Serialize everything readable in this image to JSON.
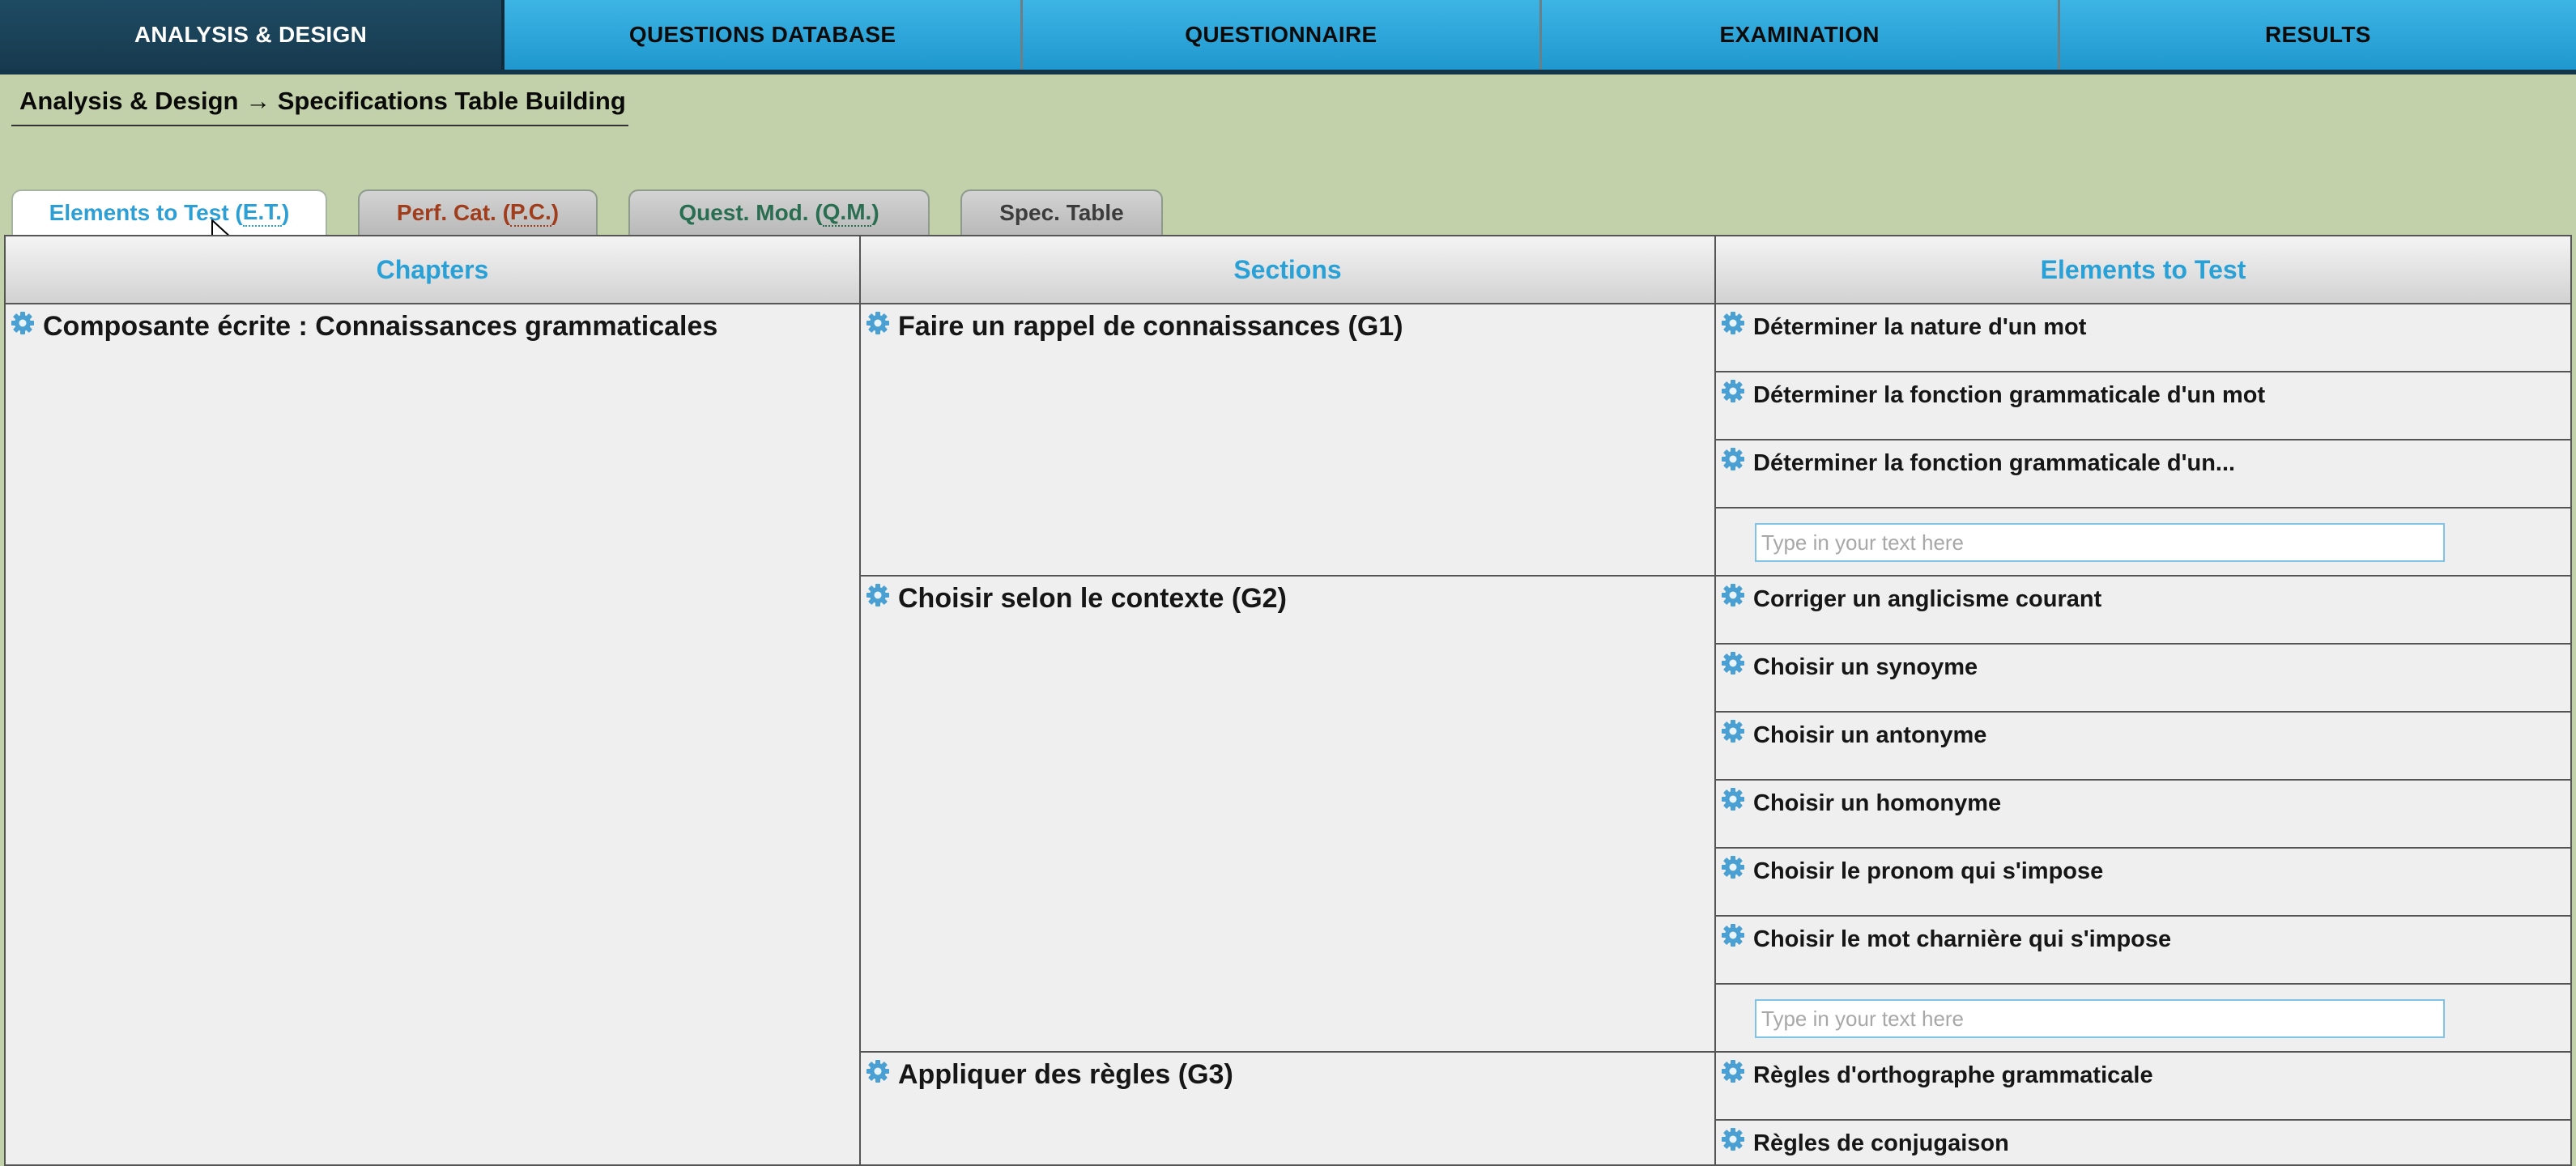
{
  "topnav": {
    "items": [
      {
        "label": "ANALYSIS & DESIGN",
        "active": true
      },
      {
        "label": "QUESTIONS DATABASE"
      },
      {
        "label": "QUESTIONNAIRE"
      },
      {
        "label": "EXAMINATION"
      },
      {
        "label": "RESULTS"
      }
    ]
  },
  "breadcrumb": {
    "parent": "Analysis & Design",
    "separator": " → ",
    "current": "Specifications Table Building"
  },
  "tabs": [
    {
      "label": "Elements to Test (",
      "abbr": "E.T.",
      "suffix": ")",
      "active": true,
      "color": "#2d9fd4"
    },
    {
      "label": "Perf. Cat. (",
      "abbr": "P.C.",
      "suffix": ")",
      "color": "#a03d1d"
    },
    {
      "label": "Quest. Mod. (",
      "abbr": "Q.M.",
      "suffix": ")",
      "color": "#2a6e52"
    },
    {
      "label": "Spec. Table",
      "color": "#3c3c3c"
    }
  ],
  "table": {
    "headers": [
      "Chapters",
      "Sections",
      "Elements to Test"
    ],
    "chapter": "Composante écrite : Connaissances grammaticales",
    "sections": [
      {
        "label": "Faire un rappel de connaissances (G1)",
        "elements": [
          "Déterminer la nature d'un mot",
          "Déterminer la fonction grammaticale d'un mot",
          "Déterminer la fonction grammaticale d'un..."
        ]
      },
      {
        "label": "Choisir selon le contexte (G2)",
        "elements": [
          "Corriger un anglicisme courant",
          "Choisir un synoyme",
          "Choisir un antonyme",
          "Choisir un homonyme",
          "Choisir le pronom qui s'impose",
          "Choisir le mot charnière qui s'impose"
        ]
      },
      {
        "label": "Appliquer des règles (G3)",
        "elements": [
          "Règles d'orthographe grammaticale",
          "Règles de conjugaison"
        ]
      }
    ],
    "input_placeholder": "Type in your text here"
  },
  "colors": {
    "page_bg": "#c2d1aa",
    "nav_blue": "#2ea6d8",
    "nav_active": "#1e4b63",
    "header_text": "#2aa1d6",
    "gear": "#4a9fd3"
  },
  "icons": {
    "gear": "gear-icon",
    "cursor": "mouse-pointer-icon"
  }
}
